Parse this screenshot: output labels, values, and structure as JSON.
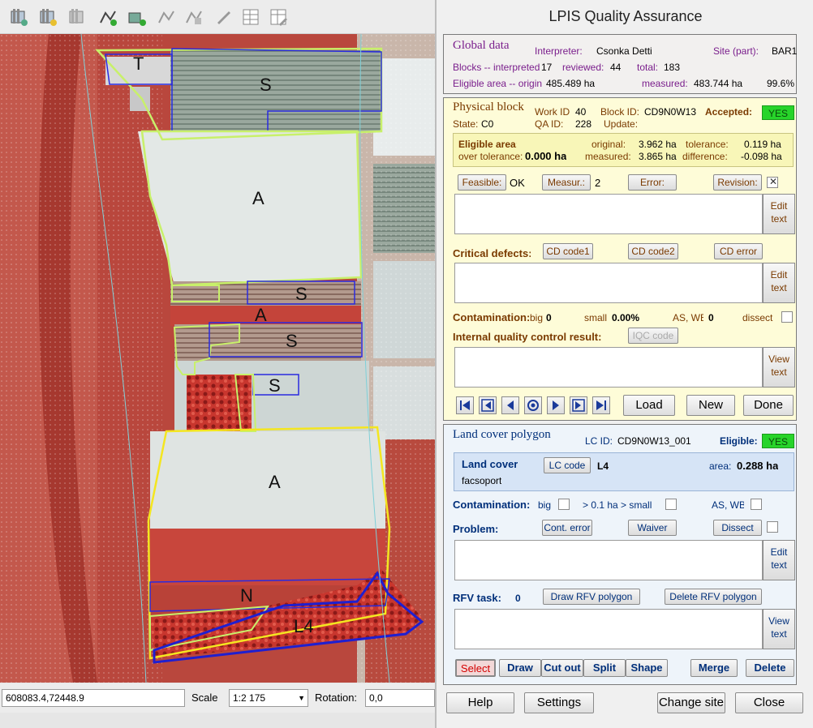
{
  "toolbar": {
    "icons": [
      "layer-icon",
      "layer-add-icon",
      "layer-remove-icon",
      "vector-add-icon",
      "vector-layer-add-icon",
      "vector-edit-icon",
      "vector-edit2-icon",
      "tool-icon",
      "table-icon",
      "table-edit-icon"
    ]
  },
  "map": {
    "labels": [
      "T",
      "S",
      "A",
      "S",
      "A",
      "S",
      "S",
      "A",
      "N",
      "L4"
    ]
  },
  "status": {
    "coordinate": "608083.4,72448.9",
    "scale_label": "Scale",
    "scale_value": "1:2 175",
    "rotation_label": "Rotation:",
    "rotation_value": "0,0"
  },
  "panel": {
    "title": "LPIS Quality Assurance",
    "global": {
      "heading": "Global data",
      "interpreter_label": "Interpreter:",
      "interpreter": "Csonka Detti",
      "site_label": "Site (part):",
      "site": "BAR1",
      "blocks_label": "Blocks -- interpreted:",
      "blocks_interpreted": "17",
      "reviewed_label": "reviewed:",
      "reviewed": "44",
      "total_label": "total:",
      "total": "183",
      "eligible_label": "Eligible area -- original:",
      "eligible_orig": "485.489 ha",
      "measured_label": "measured:",
      "measured": "483.744 ha",
      "percent": "99.6%"
    },
    "physical": {
      "heading": "Physical block",
      "work_id_label": "Work ID:",
      "work_id": "40",
      "block_id_label": "Block ID:",
      "block_id": "CD9N0W13",
      "accepted_label": "Accepted:",
      "accepted": "YES",
      "state_label": "State:",
      "state": "C0",
      "qa_id_label": "QA ID:",
      "qa_id": "228",
      "update_label": "Update:",
      "eligible_area_label": "Eligible area:",
      "original_label": "original:",
      "original": "3.962 ha",
      "tolerance_label": "tolerance:",
      "tolerance": "0.119 ha",
      "over_tol_label": "over tolerance:",
      "over_tol": "0.000 ha",
      "measured_label": "measured:",
      "measured": "3.865 ha",
      "difference_label": "difference:",
      "difference": "-0.098 ha",
      "feasible_btn": "Feasible:",
      "feasible_val": "OK",
      "measur_btn": "Measur.:",
      "measur_val": "2",
      "error_btn": "Error:",
      "revision_btn": "Revision:",
      "edit_text": "Edit text",
      "critical_label": "Critical defects:",
      "cd1": "CD code1",
      "cd2": "CD code2",
      "cderr": "CD error",
      "contam_label": "Contamination:",
      "big_label": "big",
      "big_val": "0",
      "small_label": "small",
      "small_val": "0.00%",
      "aswb_label": "AS, WB",
      "aswb_val": "0",
      "dissect_label": "dissect",
      "iqc_label": "Internal quality control result:",
      "iqc_btn": "IQC code",
      "view_text": "View text",
      "load": "Load",
      "new": "New",
      "done": "Done"
    },
    "landcover": {
      "heading": "Land cover polygon",
      "lc_id_label": "LC ID:",
      "lc_id": "CD9N0W13_001",
      "eligible_label": "Eligible:",
      "eligible": "YES",
      "lc_label": "Land cover",
      "lc_btn": "LC code",
      "lc_val": "L4",
      "area_label": "area:",
      "area_val": "0.288 ha",
      "lc_name": "facsoport",
      "contam_label": "Contamination:",
      "big_label": "big",
      "gt_label": "> 0.1 ha > small",
      "aswb_label": "AS, WB",
      "problem_label": "Problem:",
      "cont_err": "Cont. error",
      "waiver": "Waiver",
      "dissect": "Dissect",
      "edit_text": "Edit text",
      "rfv_label": "RFV task:",
      "rfv_val": "0",
      "draw_rfv": "Draw RFV polygon",
      "delete_rfv": "Delete RFV polygon",
      "view_text": "View text",
      "select": "Select",
      "draw": "Draw",
      "cutout": "Cut out",
      "split": "Split",
      "shape": "Shape",
      "merge": "Merge",
      "delete": "Delete"
    },
    "footer": {
      "help": "Help",
      "settings": "Settings",
      "change_site": "Change site",
      "close": "Close"
    },
    "colors": {
      "yes_green": "#27d42a",
      "select_red": "#d40000"
    }
  }
}
